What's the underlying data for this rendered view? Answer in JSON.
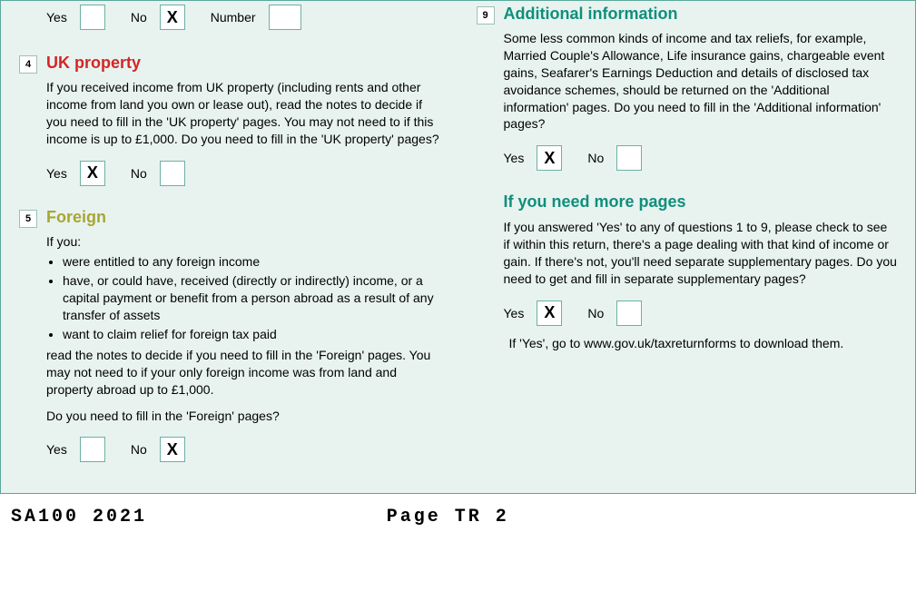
{
  "top_row": {
    "yes_label": "Yes",
    "yes_value": "",
    "no_label": "No",
    "no_value": "X",
    "number_label": "Number",
    "number_value": ""
  },
  "sections": {
    "uk_property": {
      "number": "4",
      "title": "UK property",
      "body": "If you received income from UK property (including rents and other income from land you own or lease out), read the notes to decide if you need to fill in the 'UK property' pages. You may not need to if this income is up to £1,000. Do you need to fill in the 'UK property' pages?",
      "yes_label": "Yes",
      "yes_value": "X",
      "no_label": "No",
      "no_value": ""
    },
    "foreign": {
      "number": "5",
      "title": "Foreign",
      "intro": "If you:",
      "bullet1": "were entitled to any foreign income",
      "bullet2": "have, or could have, received (directly or indirectly) income, or a capital payment or benefit from a person abroad as a result of any transfer of assets",
      "bullet3": "want to claim relief for foreign tax paid",
      "after_bullets": "read the notes to decide if you need to fill in the 'Foreign' pages. You may not need to if your only foreign income was from land and property abroad up to £1,000.",
      "question": "Do you need to fill in the 'Foreign' pages?",
      "yes_label": "Yes",
      "yes_value": "",
      "no_label": "No",
      "no_value": "X"
    },
    "additional": {
      "number": "9",
      "title": "Additional information",
      "body": "Some less common kinds of income and tax reliefs, for example, Married Couple's Allowance, Life insurance gains, chargeable event gains, Seafarer's Earnings Deduction and details of disclosed tax avoidance schemes, should be returned on the 'Additional information' pages. Do you need to fill in the 'Additional information' pages?",
      "yes_label": "Yes",
      "yes_value": "X",
      "no_label": "No",
      "no_value": ""
    },
    "more_pages": {
      "title": "If you need more pages",
      "body": "If you answered 'Yes' to any of questions 1 to 9, please check to see if within this return, there's a page dealing with that kind of income or gain. If there's not, you'll need separate supplementary pages. Do you need to get and fill in separate supplementary pages?",
      "yes_label": "Yes",
      "yes_value": "X",
      "no_label": "No",
      "no_value": "",
      "note": "If 'Yes', go to www.gov.uk/taxreturnforms to download them."
    }
  },
  "footer": {
    "form_code": "SA100 2021",
    "page": "Page TR 2"
  }
}
